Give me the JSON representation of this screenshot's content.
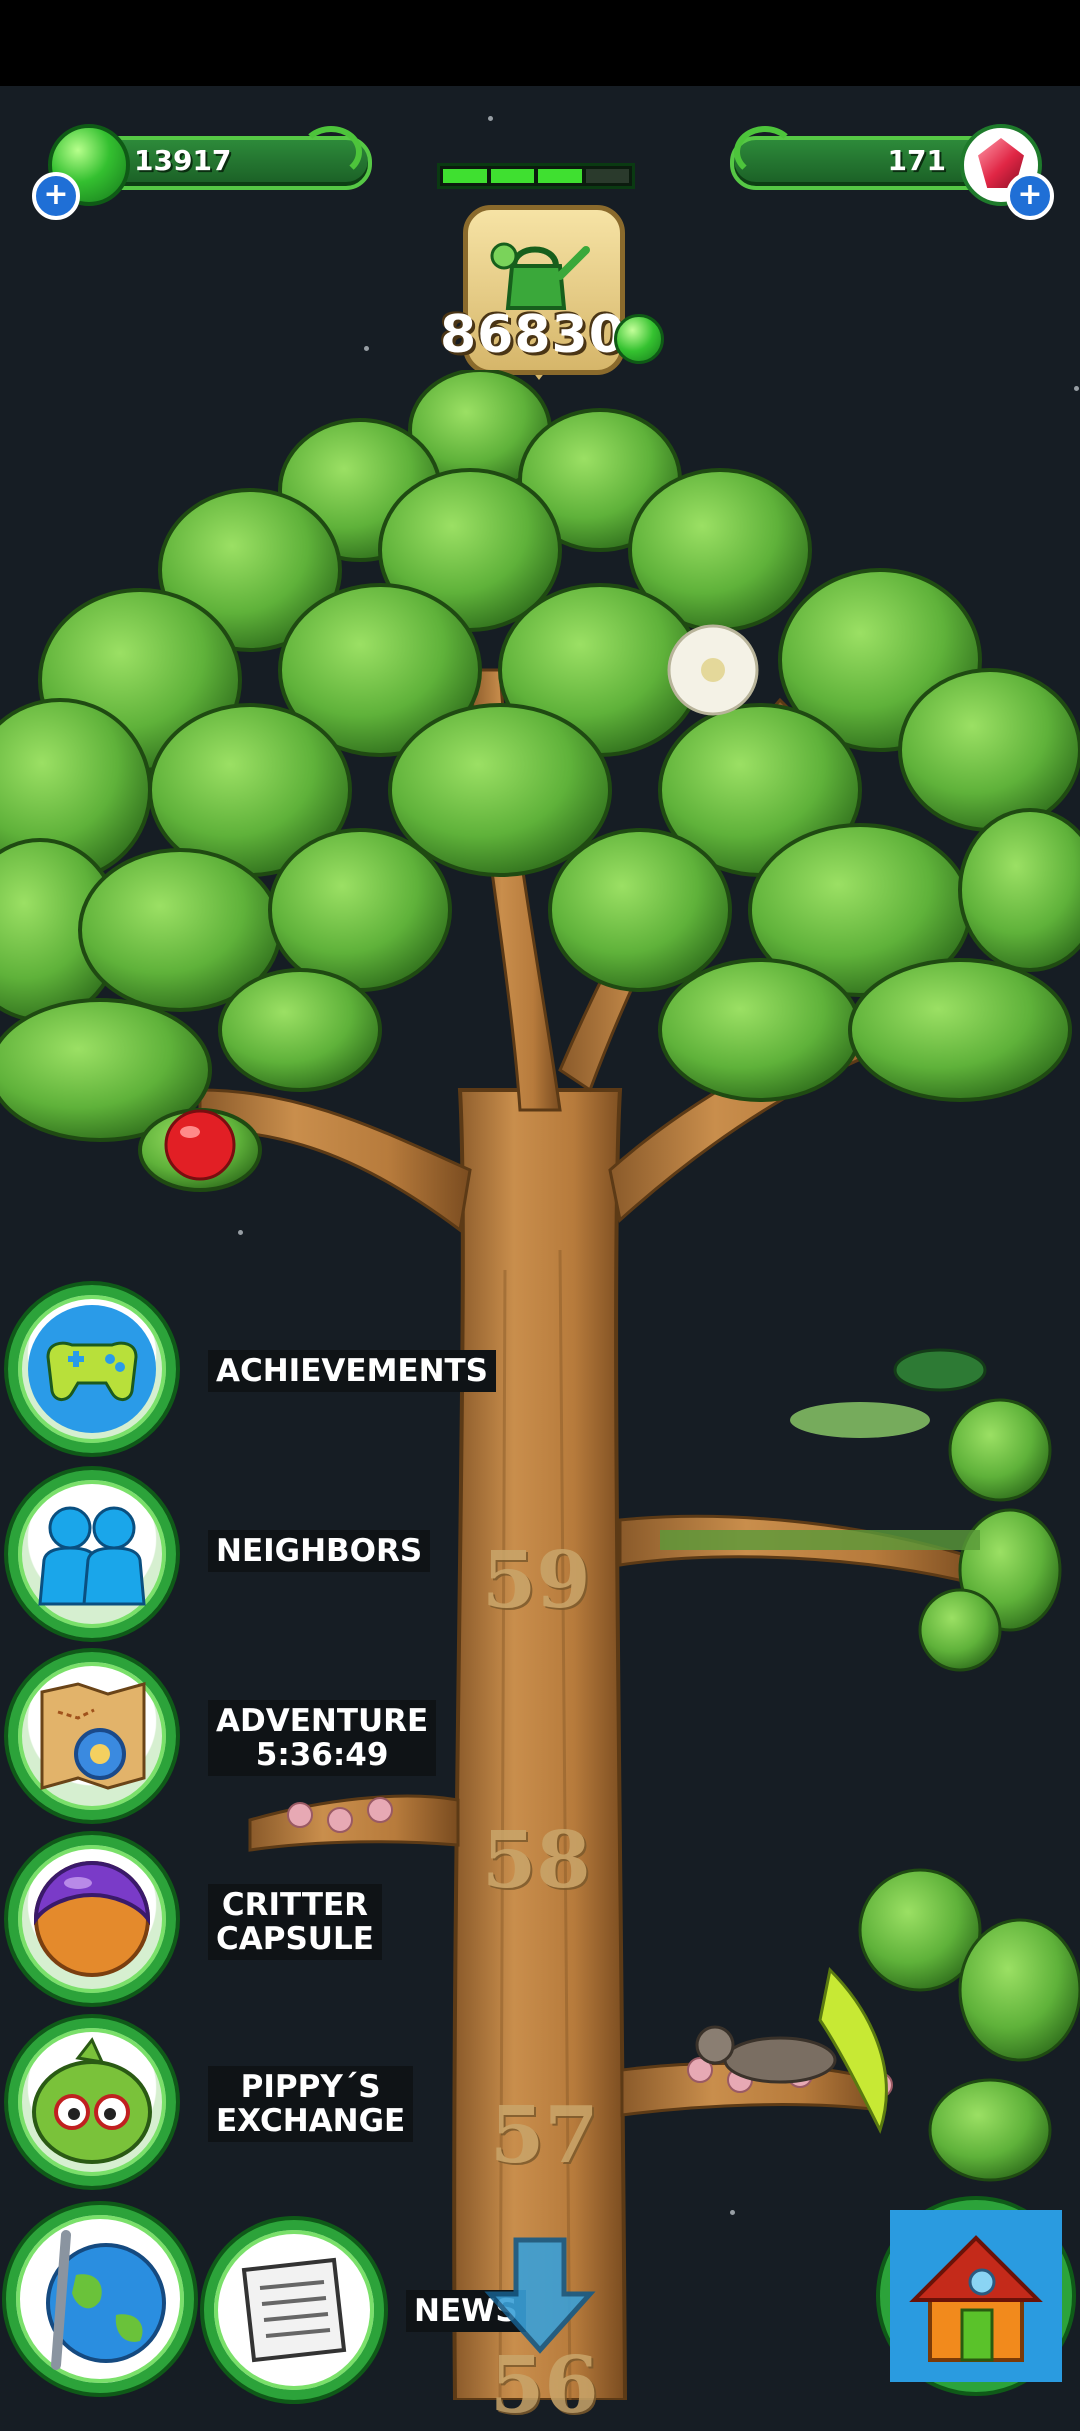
{
  "resources": {
    "green_gems": "13917",
    "red_gems": "171"
  },
  "water": {
    "progress": {
      "filled_segments": 3,
      "total_segments": 4
    },
    "count": "86830"
  },
  "tree_levels": [
    "59",
    "58",
    "57",
    "56"
  ],
  "menu": {
    "achievements": "ACHIEVEMENTS",
    "neighbors": "NEIGHBORS",
    "adventure": "ADVENTURE",
    "adventure_timer": "5:36:49",
    "critter_capsule_1": "CRITTER",
    "critter_capsule_2": "CAPSULE",
    "pippys_exchange_1": "PIPPY´S",
    "pippys_exchange_2": "EXCHANGE",
    "news": "NEWS"
  },
  "icons": {
    "gamepad": "gamepad-icon",
    "neighbors": "people-icon",
    "adventure": "treasure-map-icon",
    "capsule": "capsule-icon",
    "exchange": "pippy-face-icon",
    "globe": "globe-icon",
    "news": "newspaper-icon",
    "home": "house-icon",
    "down": "down-arrow-icon"
  }
}
